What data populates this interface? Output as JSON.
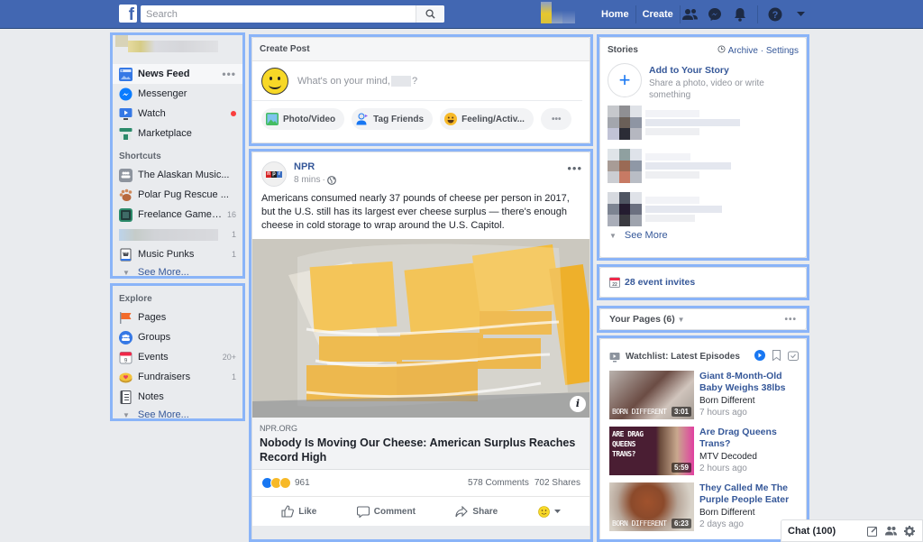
{
  "topbar": {
    "logo": "f",
    "search_placeholder": "Search",
    "nav": [
      "Home",
      "Create"
    ],
    "icons": [
      "friends-icon",
      "messenger-icon",
      "notifications-icon",
      "help-icon",
      "account-menu-icon"
    ],
    "brand_color": "#4267b2"
  },
  "left_sidebar": {
    "main": [
      {
        "label": "News Feed",
        "icon": "news-feed-icon",
        "active": true,
        "more": "•••"
      },
      {
        "label": "Messenger",
        "icon": "messenger-icon"
      },
      {
        "label": "Watch",
        "icon": "watch-icon",
        "notification_dot": true
      },
      {
        "label": "Marketplace",
        "icon": "marketplace-icon"
      }
    ],
    "shortcuts_heading": "Shortcuts",
    "shortcuts": [
      {
        "label": "The Alaskan Music...",
        "icon": "group-icon",
        "count": ""
      },
      {
        "label": "Polar Pug Rescue ...",
        "icon": "paw-icon",
        "count": ""
      },
      {
        "label": "Freelance Game J...",
        "icon": "game-icon",
        "count": "16"
      },
      {
        "label": "",
        "icon": "blurred-icon",
        "count": "1",
        "blurred": true
      },
      {
        "label": "Music Punks",
        "icon": "rock-hand-icon",
        "count": "1"
      }
    ],
    "shortcuts_see_more": "See More...",
    "explore_heading": "Explore",
    "explore": [
      {
        "label": "Pages",
        "icon": "flag-icon",
        "count": ""
      },
      {
        "label": "Groups",
        "icon": "groups-icon",
        "count": ""
      },
      {
        "label": "Events",
        "icon": "calendar-icon",
        "count": "20+"
      },
      {
        "label": "Fundraisers",
        "icon": "fundraiser-icon",
        "count": "1"
      },
      {
        "label": "Notes",
        "icon": "notes-icon",
        "count": ""
      }
    ],
    "explore_see_more": "See More..."
  },
  "create_post": {
    "title": "Create Post",
    "placeholder_prefix": "What's on your mind,",
    "placeholder_suffix": "?",
    "actions": [
      "Photo/Video",
      "Tag Friends",
      "Feeling/Activ...",
      "•••"
    ]
  },
  "post": {
    "author": "NPR",
    "time": "8 mins",
    "privacy": "public",
    "text": "Americans consumed nearly 37 pounds of cheese per person in 2017, but the U.S. still has its largest ever cheese surplus — there's enough cheese in cold storage to wrap around the U.S. Capitol.",
    "link_domain": "NPR.ORG",
    "link_title": "Nobody Is Moving Our Cheese: American Surplus Reaches Record High",
    "reactions_count": "961",
    "comments": "578 Comments",
    "shares": "702 Shares",
    "actions": [
      "Like",
      "Comment",
      "Share"
    ],
    "more": "•••",
    "info": "i"
  },
  "stories": {
    "title": "Stories",
    "archive": "Archive",
    "settings": "Settings",
    "separator": "·",
    "add_title": "Add to Your Story",
    "add_sub": "Share a photo, video or write something",
    "see_more": "See More"
  },
  "events": {
    "label": "28 event invites",
    "day": "22"
  },
  "your_pages": {
    "label": "Your Pages (6)",
    "more": "•••"
  },
  "watchlist": {
    "title": "Watchlist: Latest Episodes",
    "items": [
      {
        "title": "Giant 8-Month-Old Baby Weighs 38lbs",
        "source": "Born Different",
        "time": "7 hours ago",
        "duration": "3:01",
        "caption": "BORN DIFFERENT"
      },
      {
        "title": "Are Drag Queens Trans?",
        "source": "MTV Decoded",
        "time": "2 hours ago",
        "duration": "5:59",
        "caption": "ARE DRAG QUEENS TRANS?"
      },
      {
        "title": "They Called Me The Purple People Eater",
        "source": "Born Different",
        "time": "2 days ago",
        "duration": "6:23",
        "caption": "BORN DIFFERENT"
      }
    ]
  },
  "chat": {
    "label": "Chat (100)"
  }
}
